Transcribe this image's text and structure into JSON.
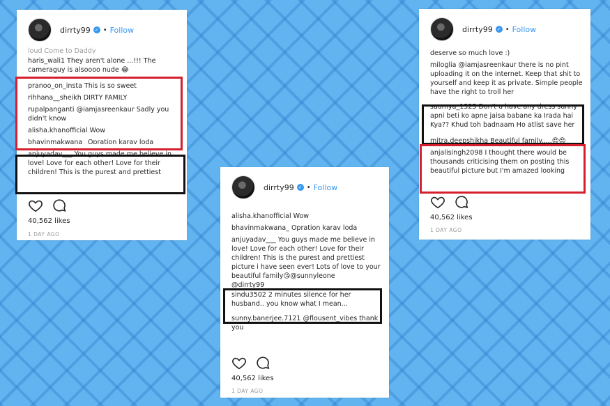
{
  "posts": [
    {
      "username": "dirrty99",
      "follow_label": "Follow",
      "comments": [
        {
          "author": "",
          "text": "loud Come to Daddy"
        },
        {
          "author": "haris_wali1",
          "text": "They aren't alone ...!!! The cameraguy is alsoooo nude 😂"
        },
        {
          "author": "pranoo_on_insta",
          "text": "This is so sweet"
        },
        {
          "author": "rihhana__sheikh",
          "text": "DIRTY FAMILY"
        },
        {
          "author": "rupalpanganti",
          "text": "@iamjasreenkaur Sadly you didn't know"
        },
        {
          "author": "alisha.khanofficial",
          "text": "Wow"
        },
        {
          "author": "bhavinmakwana_",
          "text": "Opration karav loda"
        },
        {
          "author": "anjuyadav___",
          "text": "You guys made me believe in love! Love for each other! Love for their children! This is the purest and prettiest"
        }
      ],
      "likes": "40,562 likes",
      "time": "1 DAY AGO"
    },
    {
      "username": "dirrty99",
      "follow_label": "Follow",
      "comments": [
        {
          "author": "alisha.khanofficial",
          "text": "Wow"
        },
        {
          "author": "bhavinmakwana_",
          "text": "Opration karav loda"
        },
        {
          "author": "anjuyadav___",
          "text": "You guys made me believe in love! Love for each other! Love for their children! This is the purest and prettiest picture i have seen ever! Lots of love to your beautiful family😘@sunnyleone"
        },
        {
          "author": "",
          "text": "@dirrty99"
        },
        {
          "author": "sindu3502",
          "text": "2 minutes silence for her husband.. you know what I mean..."
        },
        {
          "author": "sunny.banerjee.7121",
          "text": "@flousent_vibes thank you"
        }
      ],
      "likes": "40,562 likes",
      "time": "1 DAY AGO"
    },
    {
      "username": "dirrty99",
      "follow_label": "Follow",
      "comments": [
        {
          "author": "",
          "text": "deserve so much love :)"
        },
        {
          "author": "miloglia",
          "text": "@iamjasreenkaur there is no pint uploading it on the internet. Keep that shit to yourself and keep it as private. Simple people have the right to troll her"
        },
        {
          "author": "saumya_1525",
          "text": "Don't u have any dress sunny apni beti ko apne jaisa babane ka Irada hai Kya?? Khud toh badnaam Ho atlist save her"
        },
        {
          "author": "mitra.deepshikha",
          "text": "Beautiful family.....😍😍"
        },
        {
          "author": "anjalisingh2098",
          "text": "I thought there would be thousands criticising them on posting this beautiful picture but I'm amazed looking"
        }
      ],
      "likes": "40,562 likes",
      "time": "1 DAY AGO"
    }
  ],
  "colors": {
    "highlight_red": "#d61f2c",
    "highlight_black": "#111111",
    "link_blue": "#3897f0",
    "background": "#61b4f0"
  }
}
